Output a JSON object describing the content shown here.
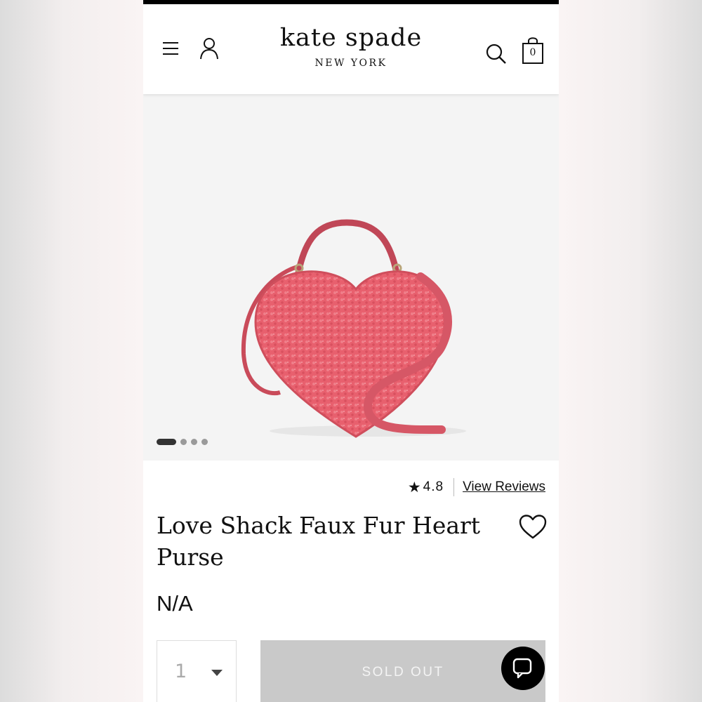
{
  "header": {
    "menu_icon": "hamburger-menu-icon",
    "account_icon": "user-icon",
    "search_icon": "search-icon",
    "bag_icon": "shopping-bag-icon",
    "bag_count": "0",
    "logo": {
      "main": "kate spade",
      "sub": "NEW YORK"
    }
  },
  "product_image": {
    "description_icon": "heart-purse-image",
    "carousel": {
      "total": 4,
      "active_index": 0
    },
    "colors": {
      "bag": "#e85a6a",
      "strap": "#cf4e5c",
      "background": "#f4f4f4"
    }
  },
  "rating": {
    "star_icon": "star-icon",
    "value": "4.8",
    "reviews_link": "View Reviews"
  },
  "product": {
    "title": "Love Shack Faux Fur Heart Purse",
    "wishlist_icon": "heart-outline-icon",
    "price": "N/A"
  },
  "purchase": {
    "quantity": "1",
    "sold_out_label": "SOLD OUT",
    "button_color": "#c9c9c9"
  },
  "chat": {
    "icon": "chat-bubble-icon"
  }
}
